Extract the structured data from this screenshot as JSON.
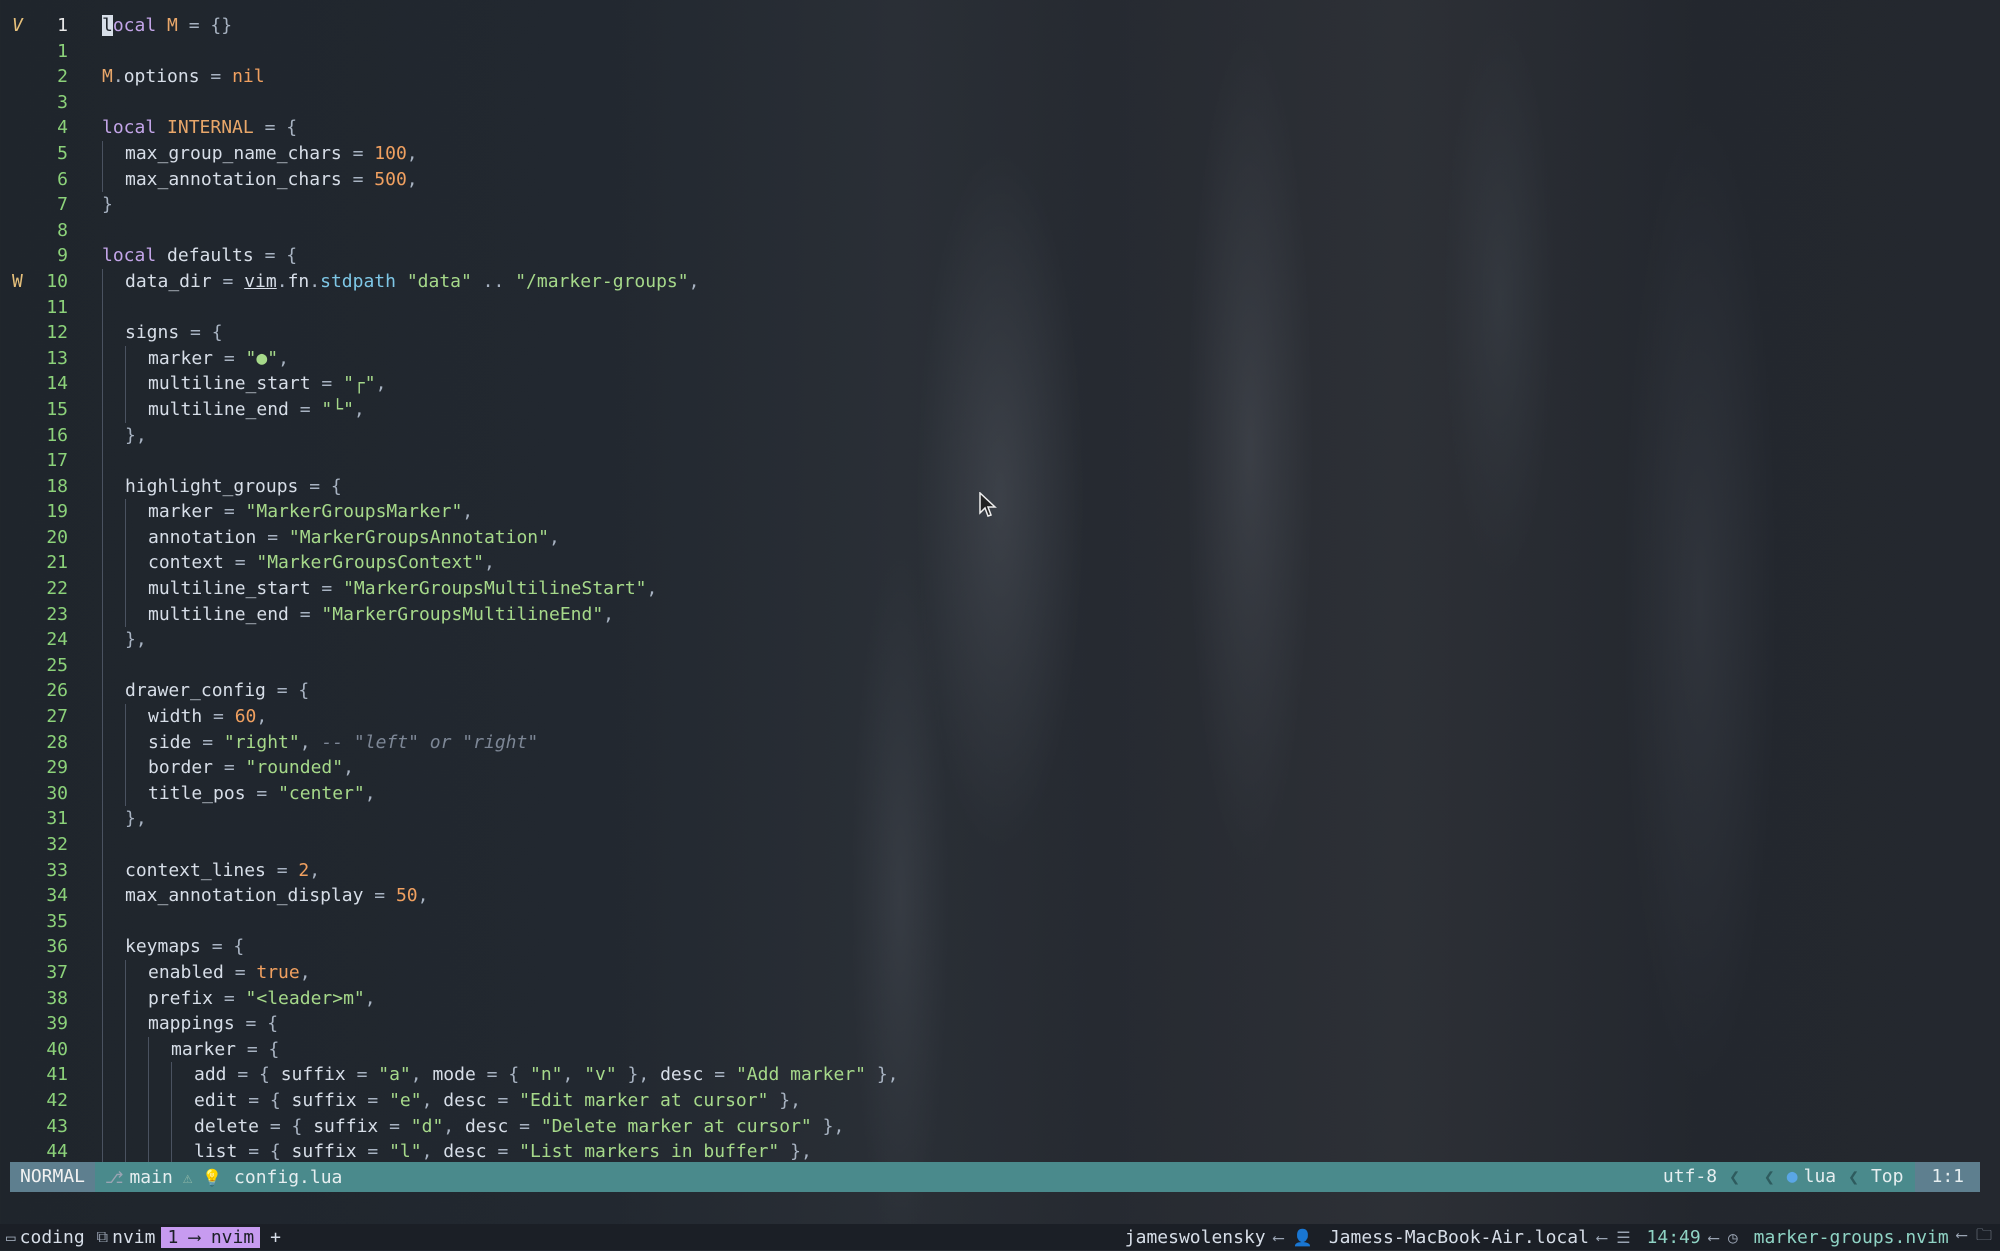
{
  "editor": {
    "lines": [
      {
        "sign": "V",
        "num": "1",
        "current": true,
        "segs": [
          [
            "cursor",
            "l"
          ],
          [
            "kw",
            "ocal "
          ],
          [
            "var",
            "M"
          ],
          [
            "op",
            " = {}"
          ]
        ]
      },
      {
        "num": "1",
        "segs": []
      },
      {
        "num": "2",
        "segs": [
          [
            "var",
            "M"
          ],
          [
            "op",
            "."
          ],
          [
            "id",
            "options"
          ],
          [
            "op",
            " = "
          ],
          [
            "numv",
            "nil"
          ]
        ]
      },
      {
        "num": "3",
        "segs": []
      },
      {
        "num": "4",
        "segs": [
          [
            "kw",
            "local "
          ],
          [
            "var",
            "INTERNAL"
          ],
          [
            "op",
            " = {"
          ]
        ]
      },
      {
        "num": "5",
        "indent": 1,
        "segs": [
          [
            "id",
            "max_group_name_chars"
          ],
          [
            "op",
            " = "
          ],
          [
            "numv",
            "100"
          ],
          [
            "op",
            ","
          ]
        ]
      },
      {
        "num": "6",
        "indent": 1,
        "segs": [
          [
            "id",
            "max_annotation_chars"
          ],
          [
            "op",
            " = "
          ],
          [
            "numv",
            "500"
          ],
          [
            "op",
            ","
          ]
        ]
      },
      {
        "num": "7",
        "segs": [
          [
            "op",
            "}"
          ]
        ]
      },
      {
        "num": "8",
        "segs": []
      },
      {
        "num": "9",
        "segs": [
          [
            "kw",
            "local "
          ],
          [
            "id",
            "defaults"
          ],
          [
            "op",
            " = {"
          ]
        ]
      },
      {
        "sign": "W",
        "num": "10",
        "indent": 1,
        "segs": [
          [
            "id",
            "data_dir"
          ],
          [
            "op",
            " = "
          ],
          [
            "mod",
            "vim"
          ],
          [
            "op",
            "."
          ],
          [
            "id",
            "fn"
          ],
          [
            "op",
            "."
          ],
          [
            "fn",
            "stdpath"
          ],
          [
            "op",
            " "
          ],
          [
            "str",
            "\"data\""
          ],
          [
            "op",
            " .. "
          ],
          [
            "str",
            "\"/marker-groups\""
          ],
          [
            "op",
            ","
          ]
        ]
      },
      {
        "num": "11",
        "indent": 1,
        "segs": []
      },
      {
        "num": "12",
        "indent": 1,
        "segs": [
          [
            "id",
            "signs"
          ],
          [
            "op",
            " = {"
          ]
        ]
      },
      {
        "num": "13",
        "indent": 2,
        "segs": [
          [
            "id",
            "marker"
          ],
          [
            "op",
            " = "
          ],
          [
            "str",
            "\"●\""
          ],
          [
            "op",
            ","
          ]
        ]
      },
      {
        "num": "14",
        "indent": 2,
        "segs": [
          [
            "id",
            "multiline_start"
          ],
          [
            "op",
            " = "
          ],
          [
            "str",
            "\"┌\""
          ],
          [
            "op",
            ","
          ]
        ]
      },
      {
        "num": "15",
        "indent": 2,
        "segs": [
          [
            "id",
            "multiline_end"
          ],
          [
            "op",
            " = "
          ],
          [
            "str",
            "\"└\""
          ],
          [
            "op",
            ","
          ]
        ]
      },
      {
        "num": "16",
        "indent": 1,
        "segs": [
          [
            "op",
            "},"
          ]
        ]
      },
      {
        "num": "17",
        "indent": 1,
        "segs": []
      },
      {
        "num": "18",
        "indent": 1,
        "segs": [
          [
            "id",
            "highlight_groups"
          ],
          [
            "op",
            " = {"
          ]
        ]
      },
      {
        "num": "19",
        "indent": 2,
        "segs": [
          [
            "id",
            "marker"
          ],
          [
            "op",
            " = "
          ],
          [
            "str",
            "\"MarkerGroupsMarker\""
          ],
          [
            "op",
            ","
          ]
        ]
      },
      {
        "num": "20",
        "indent": 2,
        "segs": [
          [
            "id",
            "annotation"
          ],
          [
            "op",
            " = "
          ],
          [
            "str",
            "\"MarkerGroupsAnnotation\""
          ],
          [
            "op",
            ","
          ]
        ]
      },
      {
        "num": "21",
        "indent": 2,
        "segs": [
          [
            "id",
            "context"
          ],
          [
            "op",
            " = "
          ],
          [
            "str",
            "\"MarkerGroupsContext\""
          ],
          [
            "op",
            ","
          ]
        ]
      },
      {
        "num": "22",
        "indent": 2,
        "segs": [
          [
            "id",
            "multiline_start"
          ],
          [
            "op",
            " = "
          ],
          [
            "str",
            "\"MarkerGroupsMultilineStart\""
          ],
          [
            "op",
            ","
          ]
        ]
      },
      {
        "num": "23",
        "indent": 2,
        "segs": [
          [
            "id",
            "multiline_end"
          ],
          [
            "op",
            " = "
          ],
          [
            "str",
            "\"MarkerGroupsMultilineEnd\""
          ],
          [
            "op",
            ","
          ]
        ]
      },
      {
        "num": "24",
        "indent": 1,
        "segs": [
          [
            "op",
            "},"
          ]
        ]
      },
      {
        "num": "25",
        "indent": 1,
        "segs": []
      },
      {
        "num": "26",
        "indent": 1,
        "segs": [
          [
            "id",
            "drawer_config"
          ],
          [
            "op",
            " = {"
          ]
        ]
      },
      {
        "num": "27",
        "indent": 2,
        "segs": [
          [
            "id",
            "width"
          ],
          [
            "op",
            " = "
          ],
          [
            "numv",
            "60"
          ],
          [
            "op",
            ","
          ]
        ]
      },
      {
        "num": "28",
        "indent": 2,
        "segs": [
          [
            "id",
            "side"
          ],
          [
            "op",
            " = "
          ],
          [
            "str",
            "\"right\""
          ],
          [
            "op",
            ", "
          ],
          [
            "cmt",
            "-- \"left\" or \"right\""
          ]
        ]
      },
      {
        "num": "29",
        "indent": 2,
        "segs": [
          [
            "id",
            "border"
          ],
          [
            "op",
            " = "
          ],
          [
            "str",
            "\"rounded\""
          ],
          [
            "op",
            ","
          ]
        ]
      },
      {
        "num": "30",
        "indent": 2,
        "segs": [
          [
            "id",
            "title_pos"
          ],
          [
            "op",
            " = "
          ],
          [
            "str",
            "\"center\""
          ],
          [
            "op",
            ","
          ]
        ]
      },
      {
        "num": "31",
        "indent": 1,
        "segs": [
          [
            "op",
            "},"
          ]
        ]
      },
      {
        "num": "32",
        "indent": 1,
        "segs": []
      },
      {
        "num": "33",
        "indent": 1,
        "segs": [
          [
            "id",
            "context_lines"
          ],
          [
            "op",
            " = "
          ],
          [
            "numv",
            "2"
          ],
          [
            "op",
            ","
          ]
        ]
      },
      {
        "num": "34",
        "indent": 1,
        "segs": [
          [
            "id",
            "max_annotation_display"
          ],
          [
            "op",
            " = "
          ],
          [
            "numv",
            "50"
          ],
          [
            "op",
            ","
          ]
        ]
      },
      {
        "num": "35",
        "indent": 1,
        "segs": []
      },
      {
        "num": "36",
        "indent": 1,
        "segs": [
          [
            "id",
            "keymaps"
          ],
          [
            "op",
            " = {"
          ]
        ]
      },
      {
        "num": "37",
        "indent": 2,
        "segs": [
          [
            "id",
            "enabled"
          ],
          [
            "op",
            " = "
          ],
          [
            "bool",
            "true"
          ],
          [
            "op",
            ","
          ]
        ]
      },
      {
        "num": "38",
        "indent": 2,
        "segs": [
          [
            "id",
            "prefix"
          ],
          [
            "op",
            " = "
          ],
          [
            "str",
            "\"<leader>m\""
          ],
          [
            "op",
            ","
          ]
        ]
      },
      {
        "num": "39",
        "indent": 2,
        "segs": [
          [
            "id",
            "mappings"
          ],
          [
            "op",
            " = {"
          ]
        ]
      },
      {
        "num": "40",
        "indent": 3,
        "segs": [
          [
            "id",
            "marker"
          ],
          [
            "op",
            " = {"
          ]
        ]
      },
      {
        "num": "41",
        "indent": 4,
        "segs": [
          [
            "id",
            "add"
          ],
          [
            "op",
            " = { "
          ],
          [
            "id",
            "suffix"
          ],
          [
            "op",
            " = "
          ],
          [
            "str",
            "\"a\""
          ],
          [
            "op",
            ", "
          ],
          [
            "id",
            "mode"
          ],
          [
            "op",
            " = { "
          ],
          [
            "str",
            "\"n\""
          ],
          [
            "op",
            ", "
          ],
          [
            "str",
            "\"v\""
          ],
          [
            "op",
            " }, "
          ],
          [
            "id",
            "desc"
          ],
          [
            "op",
            " = "
          ],
          [
            "str",
            "\"Add marker\""
          ],
          [
            "op",
            " },"
          ]
        ]
      },
      {
        "num": "42",
        "indent": 4,
        "segs": [
          [
            "id",
            "edit"
          ],
          [
            "op",
            " = { "
          ],
          [
            "id",
            "suffix"
          ],
          [
            "op",
            " = "
          ],
          [
            "str",
            "\"e\""
          ],
          [
            "op",
            ", "
          ],
          [
            "id",
            "desc"
          ],
          [
            "op",
            " = "
          ],
          [
            "str",
            "\"Edit marker at cursor\""
          ],
          [
            "op",
            " },"
          ]
        ]
      },
      {
        "num": "43",
        "indent": 4,
        "segs": [
          [
            "id",
            "delete"
          ],
          [
            "op",
            " = { "
          ],
          [
            "id",
            "suffix"
          ],
          [
            "op",
            " = "
          ],
          [
            "str",
            "\"d\""
          ],
          [
            "op",
            ", "
          ],
          [
            "id",
            "desc"
          ],
          [
            "op",
            " = "
          ],
          [
            "str",
            "\"Delete marker at cursor\""
          ],
          [
            "op",
            " },"
          ]
        ]
      },
      {
        "num": "44",
        "indent": 4,
        "segs": [
          [
            "id",
            "list"
          ],
          [
            "op",
            " = { "
          ],
          [
            "id",
            "suffix"
          ],
          [
            "op",
            " = "
          ],
          [
            "str",
            "\"l\""
          ],
          [
            "op",
            ", "
          ],
          [
            "id",
            "desc"
          ],
          [
            "op",
            " = "
          ],
          [
            "str",
            "\"List markers in buffer\""
          ],
          [
            "op",
            " },"
          ]
        ]
      }
    ]
  },
  "statusline": {
    "mode": "NORMAL",
    "branch": "main",
    "diag_icons": "⚠ 💡",
    "filename": "config.lua",
    "encoding": "utf-8",
    "os_icon": "",
    "filetype": "lua",
    "scroll": "Top",
    "position": "1:1"
  },
  "tmux": {
    "session": "coding",
    "window_name": "nvim",
    "active_window": "1 ⟶ nvim",
    "new_window": "+",
    "user": "jameswolensky",
    "host": "Jamess-MacBook-Air.local",
    "time": "14:49",
    "project": "marker-groups.nvim"
  }
}
